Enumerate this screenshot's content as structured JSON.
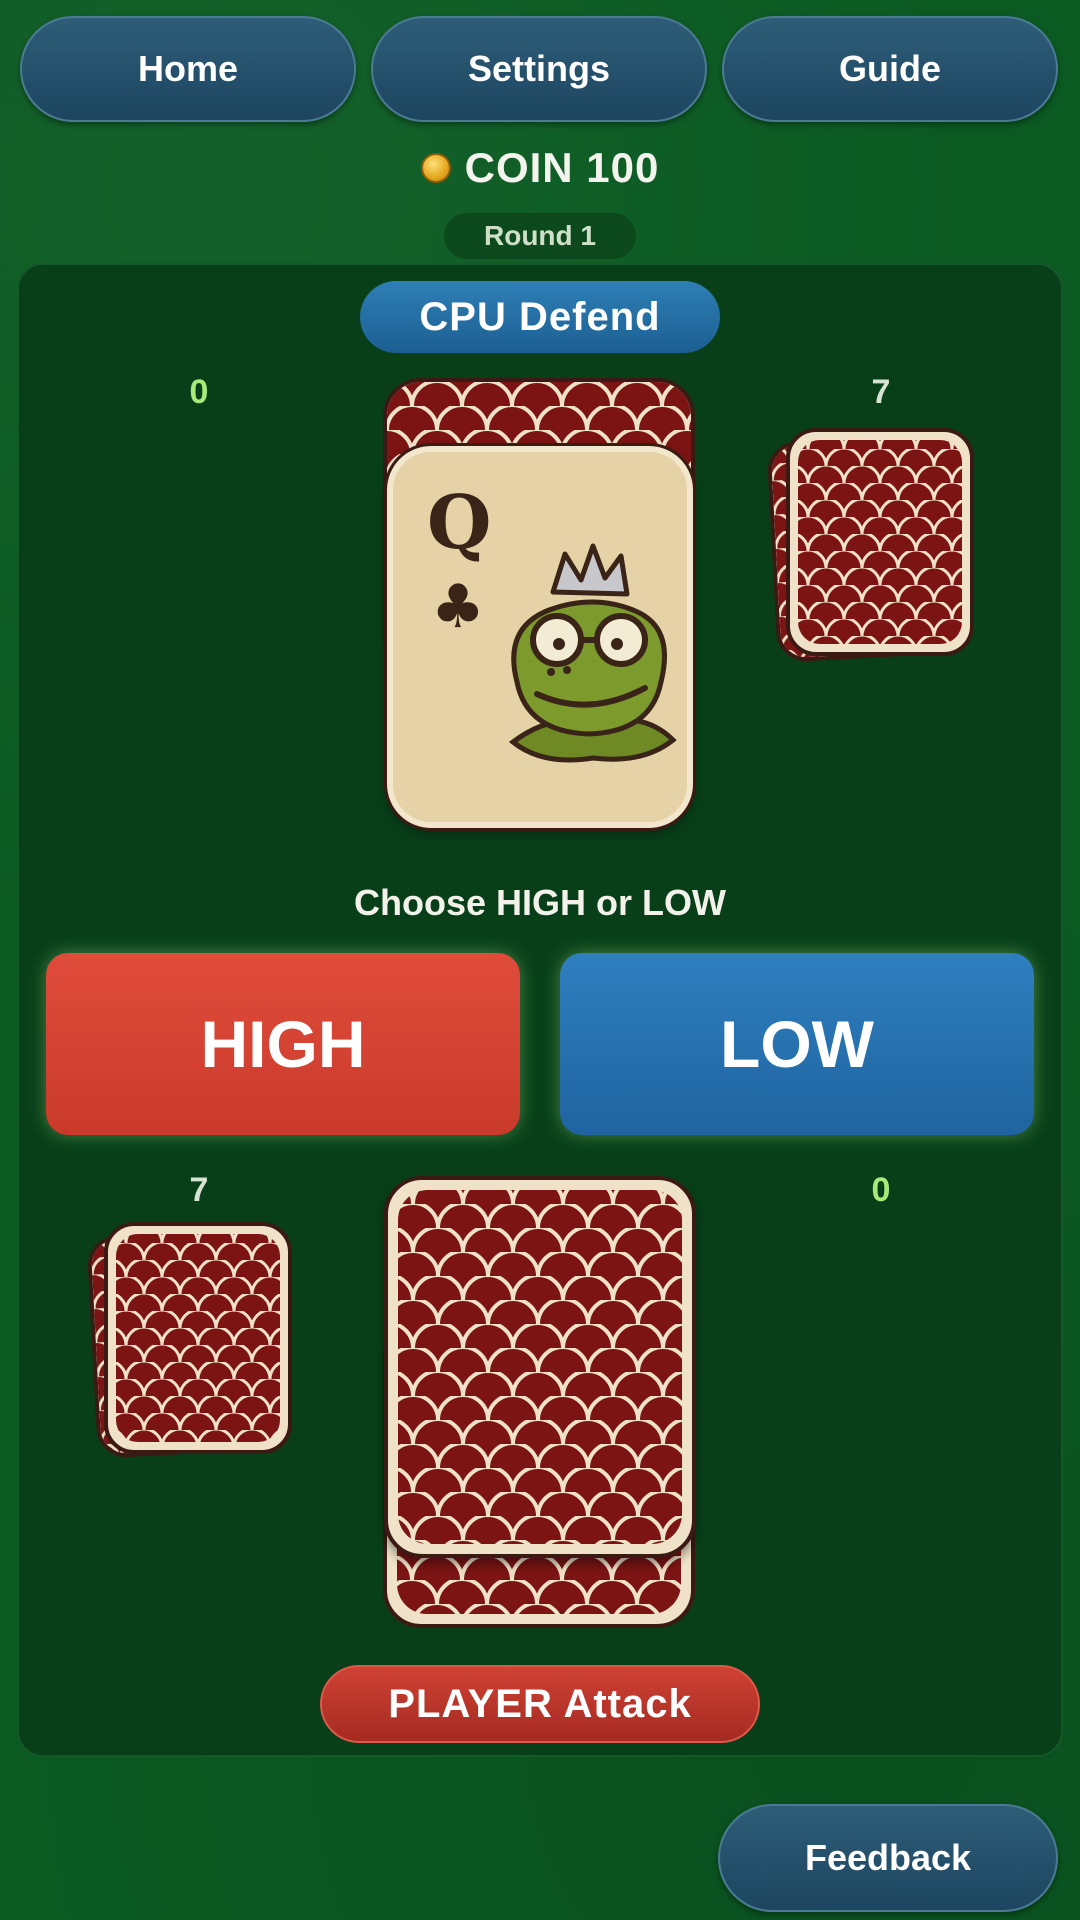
{
  "nav": {
    "home_label": "Home",
    "settings_label": "Settings",
    "guide_label": "Guide"
  },
  "coin": {
    "label": "COIN 100"
  },
  "round": {
    "label": "Round 1"
  },
  "cpu": {
    "role_label": "CPU Defend",
    "left_count": "0",
    "right_count": "7"
  },
  "revealed_card": {
    "rank": "Q",
    "suit": "♣",
    "character": "frog-king"
  },
  "prompt": "Choose HIGH or LOW",
  "buttons": {
    "high_label": "HIGH",
    "low_label": "LOW"
  },
  "player": {
    "left_count": "7",
    "right_count": "0",
    "role_label": "PLAYER Attack"
  },
  "feedback_label": "Feedback",
  "colors": {
    "felt": "#0b5a22",
    "panel": "#083f19",
    "card_back": "#7c1414",
    "card_scale_outline": "#f0e2c8",
    "high": "#e04c3b",
    "low": "#2f7fbf",
    "nav": "#2a5670"
  }
}
